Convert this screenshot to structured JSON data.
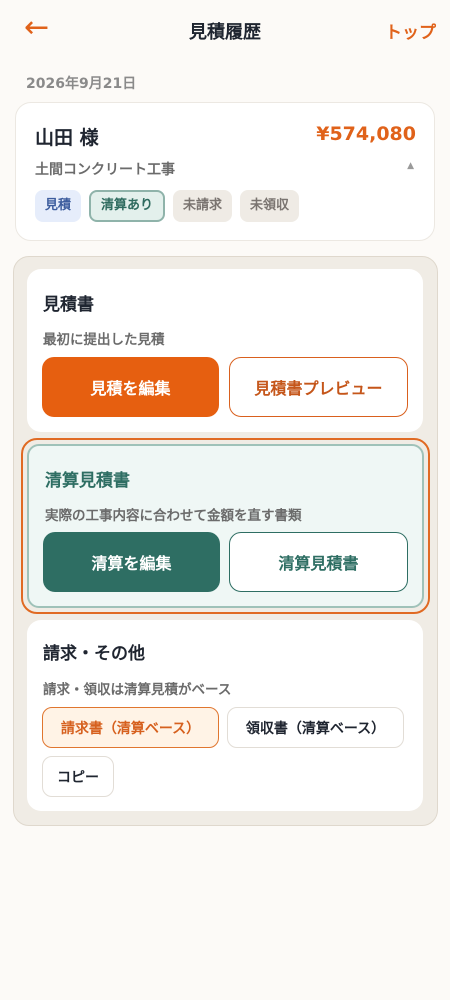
{
  "header": {
    "back_icon": "←",
    "title": "見積履歴",
    "top_link": "トップ"
  },
  "date": "2026年9月21日",
  "summary": {
    "customer": "山田 様",
    "amount": "¥574,080",
    "project": "土間コンクリート工事",
    "collapse_icon": "▲",
    "tags": [
      "見積",
      "清算あり",
      "未請求",
      "未領収"
    ]
  },
  "estimate": {
    "title": "見積書",
    "desc": "最初に提出した見積",
    "edit_label": "見積を編集",
    "preview_label": "見積書プレビュー"
  },
  "settlement": {
    "title": "清算見積書",
    "desc": "実際の工事内容に合わせて金額を直す書類",
    "edit_label": "清算を編集",
    "view_label": "清算見積書"
  },
  "other": {
    "title": "請求・その他",
    "desc": "請求・領収は清算見積がベース",
    "invoice_label": "請求書（清算ベース）",
    "receipt_label": "領収書（清算ベース）",
    "copy_label": "コピー"
  },
  "colors": {
    "accent_orange": "#e65f10",
    "accent_green": "#2e6e63",
    "background": "#fcfaf7"
  }
}
